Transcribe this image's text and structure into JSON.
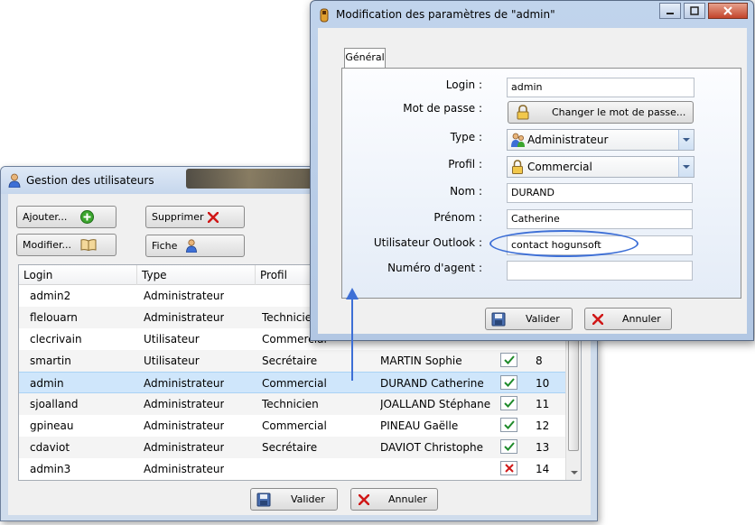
{
  "gestion": {
    "title": "Gestion des utilisateurs",
    "buttons": {
      "ajouter": "Ajouter...",
      "modifier": "Modifier...",
      "supprimer": "Supprimer",
      "fiche": "Fiche"
    },
    "columns": [
      "Login",
      "Type",
      "Profil"
    ],
    "rows": [
      {
        "login": "admin2",
        "type": "Administrateur",
        "profil": "",
        "nom": "",
        "actif": null,
        "num": ""
      },
      {
        "login": "flelouarn",
        "type": "Administrateur",
        "profil": "Technicien",
        "nom": "",
        "actif": null,
        "num": ""
      },
      {
        "login": "clecrivain",
        "type": "Utilisateur",
        "profil": "Commercial",
        "nom": "",
        "actif": null,
        "num": ""
      },
      {
        "login": "smartin",
        "type": "Utilisateur",
        "profil": "Secrétaire",
        "nom": "MARTIN Sophie",
        "actif": true,
        "num": "8"
      },
      {
        "login": "admin",
        "type": "Administrateur",
        "profil": "Commercial",
        "nom": "DURAND Catherine",
        "actif": true,
        "num": "10",
        "selected": true
      },
      {
        "login": "sjoalland",
        "type": "Administrateur",
        "profil": "Technicien",
        "nom": "JOALLAND Stéphane",
        "actif": true,
        "num": "11"
      },
      {
        "login": "gpineau",
        "type": "Administrateur",
        "profil": "Commercial",
        "nom": "PINEAU Gaëlle",
        "actif": true,
        "num": "12"
      },
      {
        "login": "cdaviot",
        "type": "Administrateur",
        "profil": "Secrétaire",
        "nom": "DAVIOT Christophe",
        "actif": true,
        "num": "13"
      },
      {
        "login": "admin3",
        "type": "Administrateur",
        "profil": "",
        "nom": "",
        "actif": false,
        "num": "14"
      }
    ],
    "valider": "Valider",
    "annuler": "Annuler"
  },
  "modif": {
    "title": "Modification des paramètres de \"admin\"",
    "tab": "Général",
    "labels": {
      "login": "Login :",
      "mdp": "Mot de passe :",
      "type": "Type :",
      "profil": "Profil :",
      "nom": "Nom :",
      "prenom": "Prénom :",
      "outlook": "Utilisateur Outlook :",
      "agent": "Numéro d'agent :"
    },
    "values": {
      "login": "admin",
      "mdp_button": "Changer le mot de passe...",
      "type": "Administrateur",
      "profil": "Commercial",
      "nom": "DURAND",
      "prenom": "Catherine",
      "outlook": "contact hogunsoft",
      "agent": ""
    },
    "valider": "Valider",
    "annuler": "Annuler"
  },
  "colors": {
    "annotation": "#3d6fd6",
    "check_green": "#1e8a2a",
    "check_red": "#d01818",
    "selected_row": "#cfe6fb"
  }
}
